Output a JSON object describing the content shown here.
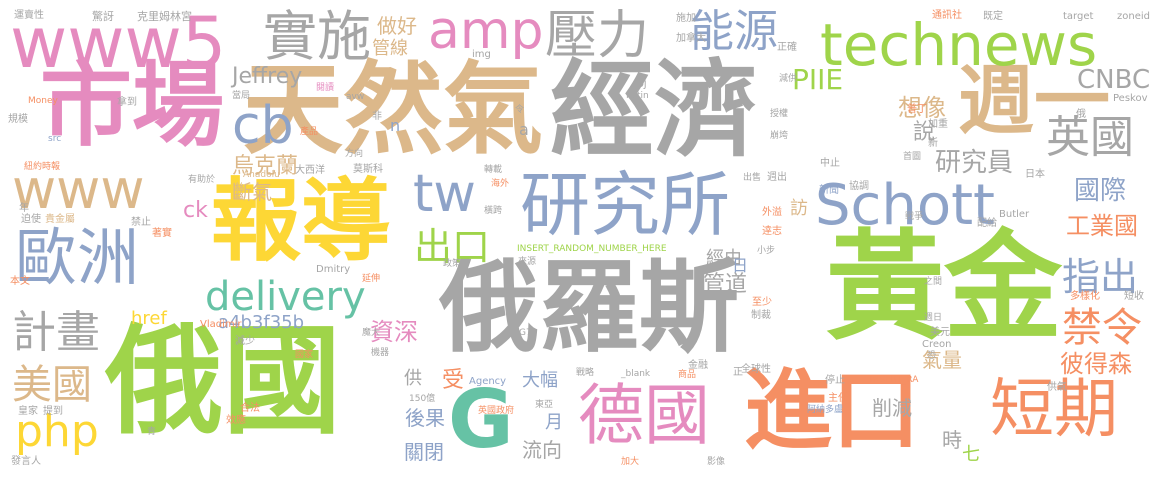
{
  "palette": {
    "tan": "#dcb88a",
    "orange": "#f58f63",
    "green": "#9fd44a",
    "grey": "#a6a6a6",
    "blue": "#8ea3c8",
    "pink": "#e58bbf",
    "yellow": "#fdd735",
    "teal": "#66c2a5"
  },
  "words": [
    {
      "text": "俄國",
      "color": "#9fd44a"
    },
    {
      "text": "經濟",
      "color": "#a6a6a6"
    },
    {
      "text": "天然氣",
      "color": "#dcb88a"
    },
    {
      "text": "黃金",
      "color": "#9fd44a"
    },
    {
      "text": "俄羅斯",
      "color": "#a6a6a6"
    },
    {
      "text": "市場",
      "color": "#e58bbf"
    },
    {
      "text": "報導",
      "color": "#fdd735"
    },
    {
      "text": "進口",
      "color": "#f58f63"
    },
    {
      "text": "週一",
      "color": "#dcb88a"
    },
    {
      "text": "研究所",
      "color": "#8ea3c8"
    },
    {
      "text": "德國",
      "color": "#e58bbf"
    },
    {
      "text": "短期",
      "color": "#f58f63"
    },
    {
      "text": "www5",
      "color": "#e58bbf"
    },
    {
      "text": "technews",
      "color": "#9fd44a"
    },
    {
      "text": "Schott",
      "color": "#8ea3c8"
    },
    {
      "text": "歐洲",
      "color": "#8ea3c8"
    },
    {
      "text": "www",
      "color": "#dcb88a"
    },
    {
      "text": "實施",
      "color": "#a6a6a6"
    },
    {
      "text": "amp",
      "color": "#e58bbf"
    },
    {
      "text": "壓力",
      "color": "#a6a6a6"
    },
    {
      "text": "能源",
      "color": "#8ea3c8"
    },
    {
      "text": "delivery",
      "color": "#66c2a5"
    },
    {
      "text": "tw",
      "color": "#8ea3c8"
    },
    {
      "text": "G",
      "color": "#66c2a5"
    },
    {
      "text": "cb",
      "color": "#8ea3c8"
    },
    {
      "text": "英國",
      "color": "#a6a6a6"
    },
    {
      "text": "php",
      "color": "#fdd735"
    },
    {
      "text": "計畫",
      "color": "#a6a6a6"
    },
    {
      "text": "美國",
      "color": "#dcb88a"
    },
    {
      "text": "出口",
      "color": "#9fd44a"
    },
    {
      "text": "禁令",
      "color": "#f58f63"
    },
    {
      "text": "指出",
      "color": "#8ea3c8"
    },
    {
      "text": "PIIE",
      "color": "#9fd44a"
    },
    {
      "text": "CNBC",
      "color": "#a6a6a6"
    },
    {
      "text": "國際",
      "color": "#8ea3c8"
    },
    {
      "text": "工業國",
      "color": "#f58f63"
    },
    {
      "text": "研究員",
      "color": "#a6a6a6"
    },
    {
      "text": "彼得森",
      "color": "#f58f63"
    },
    {
      "text": "想像",
      "color": "#dcb88a"
    },
    {
      "text": "說",
      "color": "#a6a6a6"
    },
    {
      "text": "烏克蘭",
      "color": "#dcb88a"
    },
    {
      "text": "斷氣",
      "color": "#dcb88a"
    },
    {
      "text": "Jeffrey",
      "color": "#a6a6a6"
    },
    {
      "text": "做好",
      "color": "#dcb88a"
    },
    {
      "text": "管線",
      "color": "#dcb88a"
    },
    {
      "text": "ck",
      "color": "#e58bbf"
    },
    {
      "text": "href",
      "color": "#fdd735"
    },
    {
      "text": "a4b3f35b",
      "color": "#8ea3c8"
    },
    {
      "text": "資深",
      "color": "#e58bbf"
    },
    {
      "text": "管道",
      "color": "#a6a6a6"
    },
    {
      "text": "氣量",
      "color": "#dcb88a"
    },
    {
      "text": "削減",
      "color": "#a6a6a6"
    },
    {
      "text": "後果",
      "color": "#8ea3c8"
    },
    {
      "text": "關閉",
      "color": "#8ea3c8"
    },
    {
      "text": "流向",
      "color": "#a6a6a6"
    },
    {
      "text": "大幅",
      "color": "#8ea3c8"
    },
    {
      "text": "受",
      "color": "#f58f63"
    },
    {
      "text": "供",
      "color": "#a6a6a6"
    },
    {
      "text": "月",
      "color": "#8ea3c8"
    },
    {
      "text": "時",
      "color": "#a6a6a6"
    },
    {
      "text": "七",
      "color": "#9fd44a"
    },
    {
      "text": "訪",
      "color": "#dcb88a"
    },
    {
      "text": "經由",
      "color": "#a6a6a6"
    },
    {
      "text": "日",
      "color": "#8ea3c8"
    },
    {
      "text": "運賣性",
      "color": "#a6a6a6"
    },
    {
      "text": "驚訝",
      "color": "#a6a6a6"
    },
    {
      "text": "克里姆林宮",
      "color": "#a6a6a6"
    },
    {
      "text": "施加",
      "color": "#a6a6a6"
    },
    {
      "text": "加拿大",
      "color": "#a6a6a6"
    },
    {
      "text": "通訊社",
      "color": "#f58f63"
    },
    {
      "text": "既定",
      "color": "#a6a6a6"
    },
    {
      "text": "target",
      "color": "#a6a6a6"
    },
    {
      "text": "zoneid",
      "color": "#a6a6a6"
    },
    {
      "text": "img",
      "color": "#a6a6a6"
    },
    {
      "text": "正確",
      "color": "#a6a6a6"
    },
    {
      "text": "Money",
      "color": "#f58f63"
    },
    {
      "text": "拿到",
      "color": "#a6a6a6"
    },
    {
      "text": "規模",
      "color": "#a6a6a6"
    },
    {
      "text": "src",
      "color": "#8ea3c8"
    },
    {
      "text": "紐約時報",
      "color": "#f58f63"
    },
    {
      "text": "有助於",
      "color": "#a6a6a6"
    },
    {
      "text": "年",
      "color": "#a6a6a6"
    },
    {
      "text": "迫使",
      "color": "#a6a6a6"
    },
    {
      "text": "貴金屬",
      "color": "#dcb88a"
    },
    {
      "text": "禁止",
      "color": "#a6a6a6"
    },
    {
      "text": "著實",
      "color": "#f58f63"
    },
    {
      "text": "本文",
      "color": "#f58f63"
    },
    {
      "text": "當局",
      "color": "#a6a6a6"
    },
    {
      "text": "產品",
      "color": "#f58f63"
    },
    {
      "text": "非",
      "color": "#a6a6a6"
    },
    {
      "text": "n",
      "color": "#8ea3c8"
    },
    {
      "text": "a",
      "color": "#a6a6a6"
    },
    {
      "text": "閱讀",
      "color": "#e58bbf"
    },
    {
      "text": "avw",
      "color": "#a6a6a6"
    },
    {
      "text": "令",
      "color": "#a6a6a6"
    },
    {
      "text": "DJ",
      "color": "#a6a6a6"
    },
    {
      "text": "Putin",
      "color": "#a6a6a6"
    },
    {
      "text": "減供",
      "color": "#a6a6a6"
    },
    {
      "text": "俄",
      "color": "#a6a6a6"
    },
    {
      "text": "Peskov",
      "color": "#a6a6a6"
    },
    {
      "text": "普丁",
      "color": "#f58f63"
    },
    {
      "text": "加重",
      "color": "#a6a6a6"
    },
    {
      "text": "授權",
      "color": "#a6a6a6"
    },
    {
      "text": "新",
      "color": "#a6a6a6"
    },
    {
      "text": "崩垮",
      "color": "#a6a6a6"
    },
    {
      "text": "首圖",
      "color": "#a6a6a6"
    },
    {
      "text": "大西洋",
      "color": "#a6a6a6"
    },
    {
      "text": "莫斯科",
      "color": "#a6a6a6"
    },
    {
      "text": "方向",
      "color": "#a6a6a6"
    },
    {
      "text": "Anadolu",
      "color": "#dcb88a"
    },
    {
      "text": "轉載",
      "color": "#a6a6a6"
    },
    {
      "text": "海外",
      "color": "#f58f63"
    },
    {
      "text": "出售",
      "color": "#a6a6a6"
    },
    {
      "text": "週出",
      "color": "#a6a6a6"
    },
    {
      "text": "中止",
      "color": "#a6a6a6"
    },
    {
      "text": "日本",
      "color": "#a6a6a6"
    },
    {
      "text": "新聞",
      "color": "#8ea3c8"
    },
    {
      "text": "協調",
      "color": "#a6a6a6"
    },
    {
      "text": "橫跨",
      "color": "#a6a6a6"
    },
    {
      "text": "外溢",
      "color": "#f58f63"
    },
    {
      "text": "INSERT_RANDOM_NUMBER_HERE",
      "color": "#9fd44a"
    },
    {
      "text": "戰爭",
      "color": "#a6a6a6"
    },
    {
      "text": "逹志",
      "color": "#f58f63"
    },
    {
      "text": "配給",
      "color": "#a6a6a6"
    },
    {
      "text": "Butler",
      "color": "#a6a6a6"
    },
    {
      "text": "Dmitry",
      "color": "#a6a6a6"
    },
    {
      "text": "政策",
      "color": "#a6a6a6"
    },
    {
      "text": "來源",
      "color": "#a6a6a6"
    },
    {
      "text": "小步",
      "color": "#a6a6a6"
    },
    {
      "text": "延伸",
      "color": "#f58f63"
    },
    {
      "text": "之間",
      "color": "#a6a6a6"
    },
    {
      "text": "多樣化",
      "color": "#f58f63"
    },
    {
      "text": "短收",
      "color": "#a6a6a6"
    },
    {
      "text": "至少",
      "color": "#f58f63"
    },
    {
      "text": "制裁",
      "color": "#a6a6a6"
    },
    {
      "text": "週日",
      "color": "#a6a6a6"
    },
    {
      "text": "Vladimir",
      "color": "#f58f63"
    },
    {
      "text": "減少",
      "color": "#a6a6a6"
    },
    {
      "text": "魔大",
      "color": "#a6a6a6"
    },
    {
      "text": "美元",
      "color": "#a6a6a6"
    },
    {
      "text": "G7",
      "color": "#a6a6a6"
    },
    {
      "text": "Creon",
      "color": "#a6a6a6"
    },
    {
      "text": "國家",
      "color": "#f58f63"
    },
    {
      "text": "機器",
      "color": "#a6a6a6"
    },
    {
      "text": "恐",
      "color": "#a6a6a6"
    },
    {
      "text": "Agency",
      "color": "#8ea3c8"
    },
    {
      "text": "戰略",
      "color": "#a6a6a6"
    },
    {
      "text": "_blank",
      "color": "#a6a6a6"
    },
    {
      "text": "商品",
      "color": "#f58f63"
    },
    {
      "text": "全球性",
      "color": "#a6a6a6"
    },
    {
      "text": "停止",
      "color": "#a6a6a6"
    },
    {
      "text": "INSERT_RA",
      "color": "#f58f63"
    },
    {
      "text": "供氣",
      "color": "#a6a6a6"
    },
    {
      "text": "正",
      "color": "#a6a6a6"
    },
    {
      "text": "金融",
      "color": "#a6a6a6"
    },
    {
      "text": "合法",
      "color": "#f58f63"
    },
    {
      "text": "效應",
      "color": "#f58f63"
    },
    {
      "text": "150億",
      "color": "#a6a6a6"
    },
    {
      "text": "英國政府",
      "color": "#f58f63"
    },
    {
      "text": "東亞",
      "color": "#a6a6a6"
    },
    {
      "text": "阿納多盧",
      "color": "#8ea3c8"
    },
    {
      "text": "主任",
      "color": "#f58f63"
    },
    {
      "text": "皇家",
      "color": "#a6a6a6"
    },
    {
      "text": "提到",
      "color": "#a6a6a6"
    },
    {
      "text": "青",
      "color": "#a6a6a6"
    },
    {
      "text": "發言人",
      "color": "#a6a6a6"
    },
    {
      "text": "加大",
      "color": "#f58f63"
    },
    {
      "text": "影像",
      "color": "#a6a6a6"
    }
  ]
}
